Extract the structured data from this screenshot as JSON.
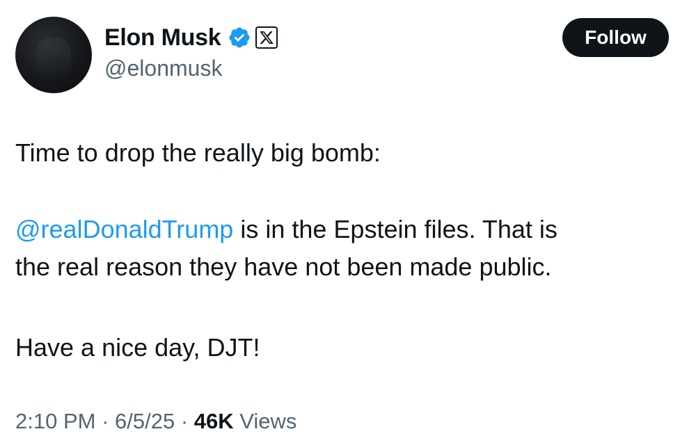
{
  "author": {
    "display_name": "Elon Musk",
    "handle": "@elonmusk",
    "verified_badge_color": "#1d9bf0",
    "affiliate_badge": "x-logo"
  },
  "follow_button": {
    "label": "Follow"
  },
  "tweet": {
    "line1": "Time to drop the really big bomb:",
    "mention": "@realDonaldTrump",
    "line2_rest": " is in the Epstein files. That is",
    "line3": "the real reason they have not been made public.",
    "line4": "Have a nice day, DJT!"
  },
  "meta": {
    "time": "2:10 PM",
    "sep1": " · ",
    "date": "6/5/25",
    "sep2": " · ",
    "views_count": "46K",
    "views_label": " Views"
  },
  "colors": {
    "text": "#0f1419",
    "secondary": "#536471",
    "link": "#1d9bf0",
    "button_bg": "#0f1419"
  }
}
